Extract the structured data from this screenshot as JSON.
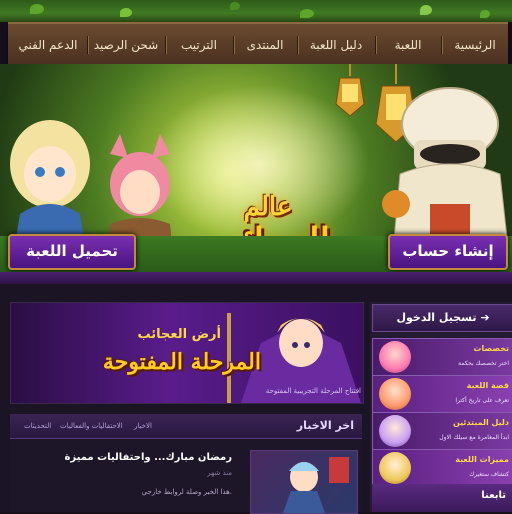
{
  "nav": {
    "items": [
      "الرئيسية",
      "اللعبة",
      "دليل اللعبة",
      "المنتدى",
      "الترتيب",
      "شحن الرصيد",
      "الدعم الفني"
    ]
  },
  "banner": {
    "logo_line1": "عالم",
    "logo_line2": "العجائب"
  },
  "buttons": {
    "create_account": "إنشاء حساب",
    "download_game": "تحميل اللعبة"
  },
  "slider": {
    "title_small": "أرض العجائب",
    "title_big": "المرحلة المفتوحة",
    "caption": "افتتاح المرحلة التجريبية المفتوحة"
  },
  "news": {
    "heading": "اخر الاخبار",
    "tabs": [
      "الاخبار",
      "الاحتفاليات والفعاليات",
      "التحديثات"
    ],
    "item": {
      "title": "رمضان مبارك... واحتفاليات مميزة",
      "date": "منذ شهر",
      "body": "هذا الخبر وصلة لروابط خارجي."
    }
  },
  "sidebar": {
    "login": "تسجيل الدخول",
    "cards": [
      {
        "title": "تخصصات",
        "sub": "اختر تخصصك بحكمة"
      },
      {
        "title": "قصة اللعبة",
        "sub": "تعرف على تاريخ أكترا"
      },
      {
        "title": "دليل المبتدئين",
        "sub": "ابدأ المغامرة مع سيلك الاول"
      },
      {
        "title": "مميزات اللعبة",
        "sub": "كتشاف ستغيرك"
      }
    ],
    "footer": "تابعنا"
  },
  "colors": {
    "accent": "#ffcc22",
    "purple": "#5a1c8c",
    "nav": "#4a3020"
  }
}
